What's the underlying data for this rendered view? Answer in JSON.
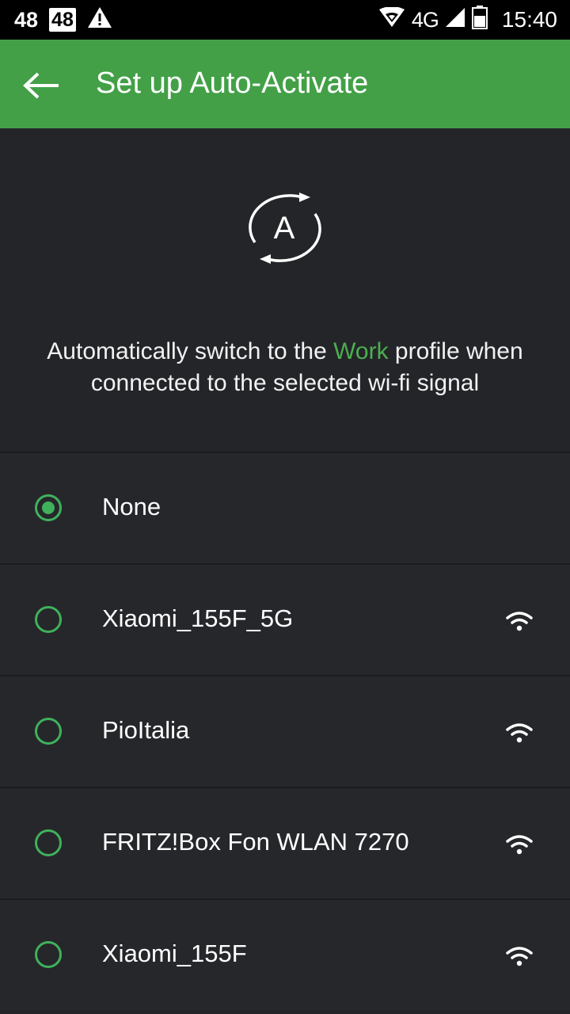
{
  "status_bar": {
    "left_num": "48",
    "boxed_num": "48",
    "network": "4G",
    "time": "15:40"
  },
  "app_bar": {
    "title": "Set up Auto-Activate"
  },
  "header": {
    "icon_letter": "A",
    "description_pre": "Automatically switch to the ",
    "description_highlight": "Work",
    "description_post": " profile when connected to the selected wi-fi signal"
  },
  "colors": {
    "accent": "#43a047",
    "radio": "#3fb15b",
    "background": "#242529"
  },
  "wifi_list": {
    "items": [
      {
        "label": "None",
        "selected": true,
        "has_signal": false
      },
      {
        "label": "Xiaomi_155F_5G",
        "selected": false,
        "has_signal": true
      },
      {
        "label": "PioItalia",
        "selected": false,
        "has_signal": true
      },
      {
        "label": "FRITZ!Box Fon WLAN 7270",
        "selected": false,
        "has_signal": true
      },
      {
        "label": "Xiaomi_155F",
        "selected": false,
        "has_signal": true
      }
    ]
  }
}
